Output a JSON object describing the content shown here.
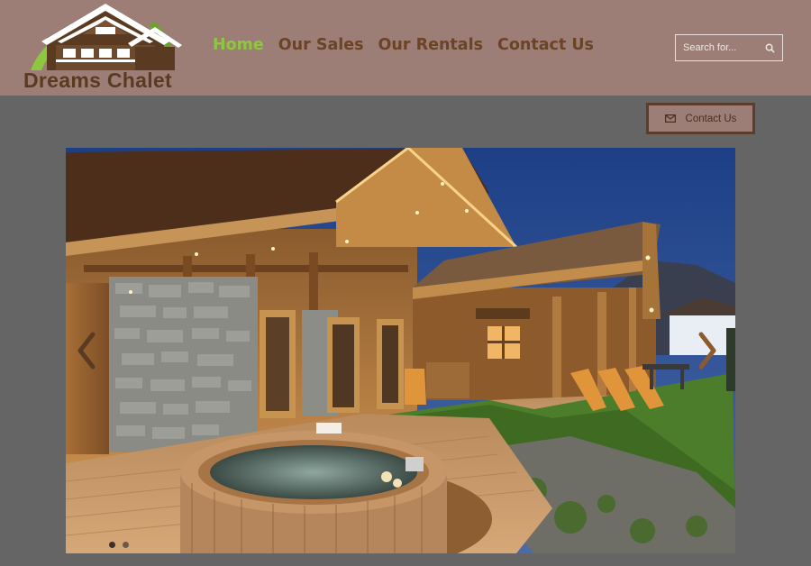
{
  "header": {
    "logo": {
      "text": "Dreams Chalet",
      "icon": "chalet-logo-icon"
    },
    "nav": {
      "items": [
        {
          "label": "Home",
          "active": true
        },
        {
          "label": "Our Sales",
          "active": false
        },
        {
          "label": "Our Rentals",
          "active": false
        },
        {
          "label": "Contact Us",
          "active": false
        }
      ]
    },
    "search": {
      "placeholder": "Search for...",
      "icon": "search-icon"
    }
  },
  "contact_button": {
    "label": "Contact Us",
    "icon": "envelope-icon"
  },
  "slider": {
    "image": "chalet-hot-tub-night-photo",
    "prev_icon": "chevron-left-icon",
    "next_icon": "chevron-right-icon",
    "slide_count": 2,
    "active_slide": 1
  },
  "colors": {
    "header_bg": "#9c7e76",
    "page_bg": "#666565",
    "nav_text": "#6b4325",
    "nav_active": "#8dc63f",
    "button_border": "#5e3c2a"
  }
}
